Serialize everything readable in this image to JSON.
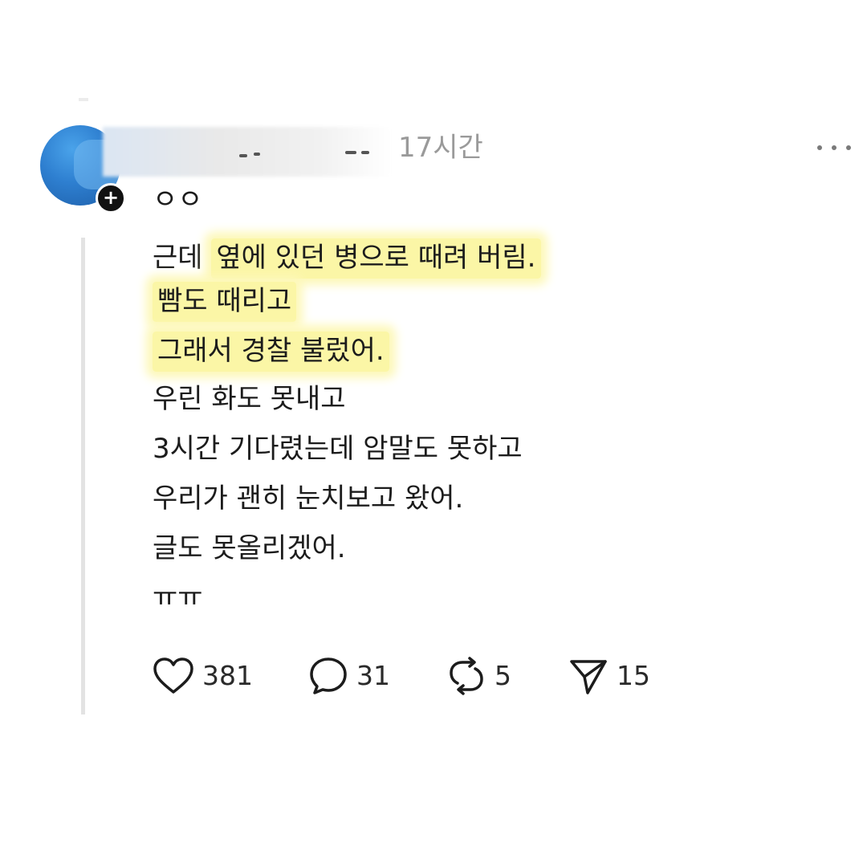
{
  "post": {
    "timestamp": "17시간",
    "lines": [
      "ㅇㅇ",
      "근데 ",
      "옆에 있던 병으로 때려 버림.",
      "빰도 때리고",
      "그래서 경찰 불렀어.",
      "우린 화도 못내고",
      "3시간 기다렸는데 암말도 못하고",
      "우리가 괜히 눈치보고 왔어.",
      "글도 못올리겠어.",
      "ㅠㅠ"
    ]
  },
  "actions": {
    "like_count": "381",
    "comment_count": "31",
    "repost_count": "5",
    "share_count": "15"
  },
  "icons": {
    "like": "heart-icon",
    "comment": "speech-bubble-icon",
    "repost": "repost-arrows-icon",
    "share": "paper-plane-icon",
    "more": "more-dots-icon",
    "follow": "plus-icon"
  },
  "colors": {
    "highlight": "#fbf6a6",
    "timestamp": "#9a9a9a",
    "avatar": "#2e7fd0"
  }
}
